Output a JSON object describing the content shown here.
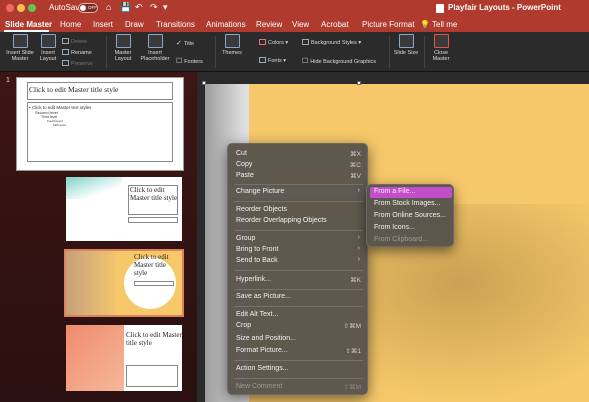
{
  "titlebar": {
    "autosave_label": "AutoSave",
    "autosave_state": "OFF",
    "quick_access": [
      "⌂",
      "💾",
      "↶",
      "↷",
      "▾"
    ],
    "document_title": "Playfair Layouts - PowerPoint"
  },
  "tabs": [
    "Slide Master",
    "Home",
    "Insert",
    "Draw",
    "Transitions",
    "Animations",
    "Review",
    "View",
    "Acrobat",
    "Picture Format",
    "Tell me"
  ],
  "ribbon": {
    "insert_slide_master": "Insert Slide Master",
    "insert_layout": "Insert Layout",
    "delete": "Delete",
    "rename": "Rename",
    "preserve": "Preserve",
    "master_layout": "Master Layout",
    "insert_placeholder": "Insert Placeholder",
    "title": "Title",
    "footers": "Footers",
    "themes": "Themes",
    "colors": "Colors",
    "fonts": "Fonts",
    "background_styles": "Background Styles",
    "hide_background_graphics": "Hide Background Graphics",
    "slide_size": "Slide Size",
    "close_master": "Close Master"
  },
  "thumbnails": {
    "slide_number": "1",
    "master_title": "Click to edit Master title style",
    "master_text": "• Click to edit Master text styles",
    "second_level": "Second level",
    "third_level": "Third level",
    "fourth_level": "Fourth level",
    "fifth_level": "Fifth level",
    "layout_title": "Click to edit Master title style"
  },
  "context_menu": {
    "items": [
      {
        "label": "Cut",
        "shortcut": "⌘X"
      },
      {
        "label": "Copy",
        "shortcut": "⌘C"
      },
      {
        "label": "Paste",
        "shortcut": "⌘V"
      },
      {
        "label": "Change Picture",
        "arrow": "›"
      },
      {
        "label": "Reorder Objects"
      },
      {
        "label": "Reorder Overlapping Objects"
      },
      {
        "label": "Group",
        "arrow": "›"
      },
      {
        "label": "Bring to Front",
        "arrow": "›"
      },
      {
        "label": "Send to Back",
        "arrow": "›"
      },
      {
        "label": "Hyperlink...",
        "shortcut": "⌘K"
      },
      {
        "label": "Save as Picture..."
      },
      {
        "label": "Edit Alt Text..."
      },
      {
        "label": "Crop",
        "shortcut": "⇧⌘M"
      },
      {
        "label": "Size and Position...",
        "shortcut": ""
      },
      {
        "label": "Format Picture...",
        "shortcut": "⇧⌘1"
      },
      {
        "label": "Action Settings..."
      },
      {
        "label": "New Comment",
        "shortcut": "⇧⌘M"
      }
    ]
  },
  "submenu": {
    "items": [
      "From a File...",
      "From Stock Images...",
      "From Online Sources...",
      "From Icons...",
      "From Clipboard..."
    ]
  },
  "colors": {
    "titlebar": "#b03a2e",
    "slide_accent": "#f6c86a",
    "highlight": "#c24fc9"
  }
}
